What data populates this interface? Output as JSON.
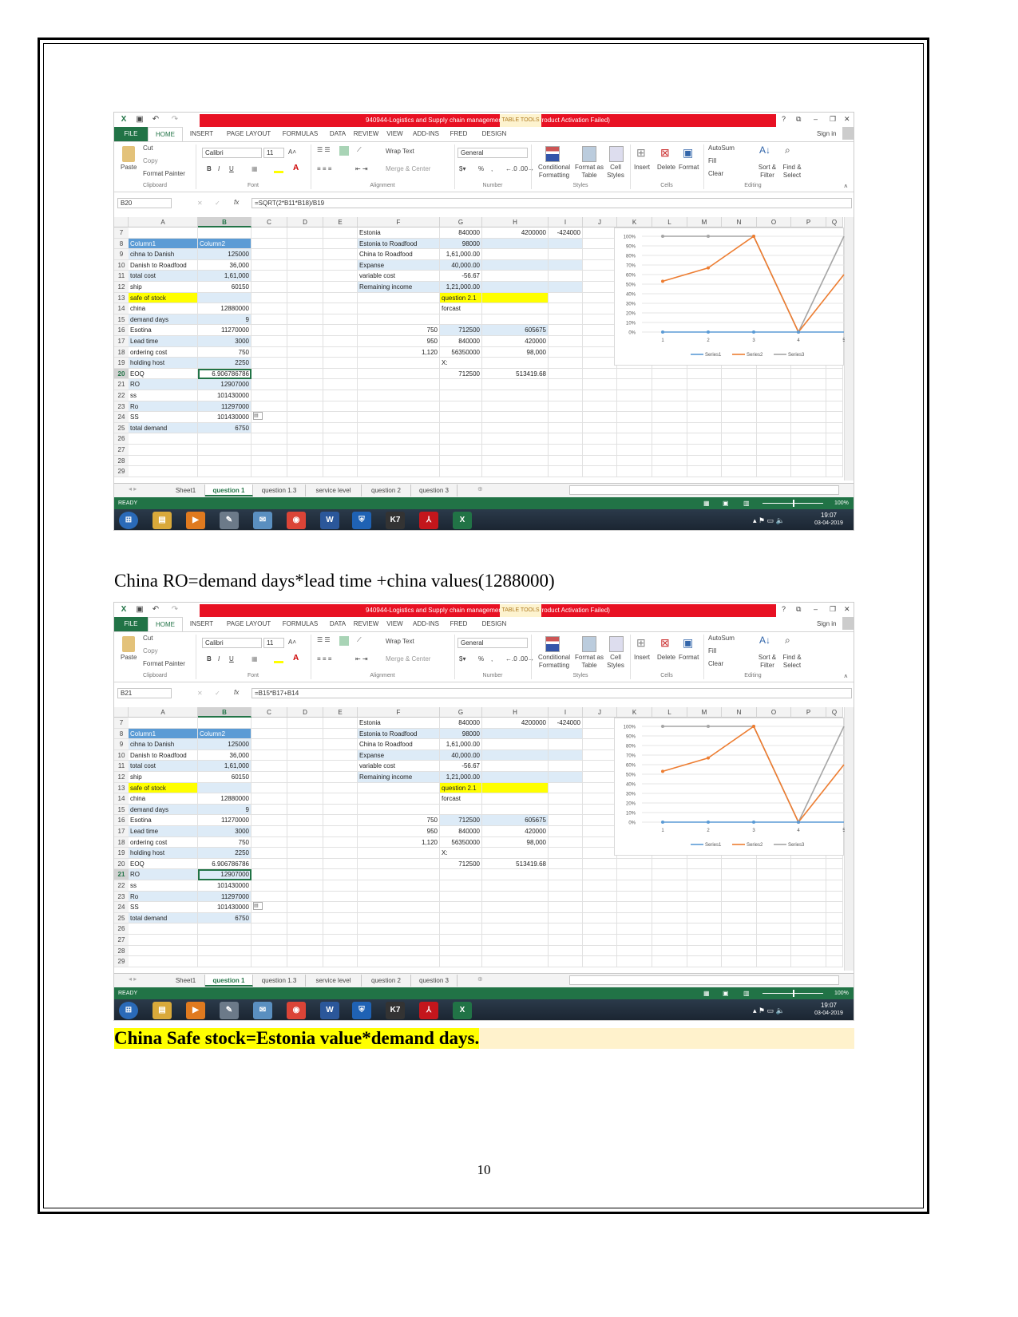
{
  "document": {
    "caption1": "China RO=demand days*lead time +china values(1288000)",
    "caption2": "China Safe stock=Estonia value*demand days.",
    "page_number": "10"
  },
  "excel": {
    "window_title": "940944-Logistics and Supply chain management v1  -  Excel (Product Activation Failed)",
    "table_tools": "TABLE TOOLS",
    "sign_in": "Sign in",
    "window_controls": [
      "?",
      "⧉",
      "–",
      "❐",
      "✕"
    ],
    "ribbon_tabs": [
      "FILE",
      "HOME",
      "INSERT",
      "PAGE LAYOUT",
      "FORMULAS",
      "DATA",
      "REVIEW",
      "VIEW",
      "ADD-INS",
      "FRED",
      "DESIGN"
    ],
    "ribbon": {
      "paste": "Paste",
      "cut": "Cut",
      "copy": "Copy",
      "format_painter": "Format Painter",
      "font_name": "Calibri",
      "font_size": "11",
      "bold": "B",
      "italic": "I",
      "underline": "U",
      "wrap_text": "Wrap Text",
      "merge_center": "Merge & Center",
      "number_format": "General",
      "percent": "%",
      "comma": ",",
      "conditional_formatting": "Conditional Formatting",
      "format_as_table": "Format as Table",
      "cell_styles": "Cell Styles",
      "insert": "Insert",
      "delete": "Delete",
      "format": "Format",
      "autosum": "AutoSum",
      "fill": "Fill",
      "clear": "Clear",
      "sort_filter": "Sort & Filter",
      "find_select": "Find & Select",
      "groups": [
        "Clipboard",
        "Font",
        "Alignment",
        "Number",
        "Styles",
        "Cells",
        "Editing"
      ]
    },
    "fx": "fx",
    "columns": [
      "A",
      "B",
      "C",
      "D",
      "E",
      "F",
      "G",
      "H",
      "I",
      "J",
      "K",
      "L",
      "M",
      "N",
      "O",
      "P",
      "Q"
    ],
    "rows": [
      7,
      8,
      9,
      10,
      11,
      12,
      13,
      14,
      15,
      16,
      17,
      18,
      19,
      20,
      21,
      22,
      23,
      24,
      25,
      26,
      27,
      28,
      29
    ],
    "cells": [
      [
        "F7",
        "Estonia",
        ""
      ],
      [
        "G7",
        "840000",
        ""
      ],
      [
        "H7",
        "4200000",
        ""
      ],
      [
        "I7",
        "-424000",
        ""
      ],
      [
        "A8",
        "Column1",
        "hdr"
      ],
      [
        "B8",
        "Column2",
        "hdr"
      ],
      [
        "F8",
        "Estonia to Roadfood",
        "band"
      ],
      [
        "G8",
        "98000",
        "band"
      ],
      [
        "H8",
        "",
        "band"
      ],
      [
        "I8",
        "",
        "band"
      ],
      [
        "A9",
        "cihna to Danish",
        "band"
      ],
      [
        "B9",
        "125000",
        "band"
      ],
      [
        "F9",
        "China to Roadfood",
        ""
      ],
      [
        "G9",
        "1,61,000.00",
        ""
      ],
      [
        "A10",
        "Danish to Roadfood",
        ""
      ],
      [
        "B10",
        "36,000",
        ""
      ],
      [
        "F10",
        "Expanse",
        "band"
      ],
      [
        "G10",
        "40,000.00",
        "band"
      ],
      [
        "H10",
        "",
        "band"
      ],
      [
        "I10",
        "",
        "band"
      ],
      [
        "A11",
        "total cost",
        "band"
      ],
      [
        "B11",
        "1,61,000",
        "band"
      ],
      [
        "F11",
        "variable cost",
        ""
      ],
      [
        "G11",
        "-56.67",
        ""
      ],
      [
        "A12",
        "ship",
        ""
      ],
      [
        "B12",
        "60150",
        ""
      ],
      [
        "F12",
        "Remaining income",
        "band"
      ],
      [
        "G12",
        "1,21,000.00",
        "band"
      ],
      [
        "H12",
        "",
        "band"
      ],
      [
        "I12",
        "",
        "band"
      ],
      [
        "A13",
        "safe of stock",
        "yellow"
      ],
      [
        "B13",
        "",
        "band"
      ],
      [
        "G13",
        "question 2.1",
        "yellow"
      ],
      [
        "H13",
        "",
        "yellow"
      ],
      [
        "A14",
        "china",
        ""
      ],
      [
        "B14",
        "12880000",
        ""
      ],
      [
        "G14",
        "forcast",
        ""
      ],
      [
        "A15",
        "demand days",
        "band"
      ],
      [
        "B15",
        "9",
        "band"
      ],
      [
        "A16",
        "Esotina",
        ""
      ],
      [
        "B16",
        "11270000",
        ""
      ],
      [
        "F16",
        "750",
        ""
      ],
      [
        "G16",
        "712500",
        "band"
      ],
      [
        "H16",
        "605675",
        "band"
      ],
      [
        "A17",
        "Lead time",
        "band"
      ],
      [
        "B17",
        "3000",
        "band"
      ],
      [
        "F17",
        "950",
        ""
      ],
      [
        "G17",
        "840000",
        ""
      ],
      [
        "H17",
        "420000",
        ""
      ],
      [
        "A18",
        "ordering cost",
        ""
      ],
      [
        "B18",
        "750",
        ""
      ],
      [
        "F18",
        "1,120",
        ""
      ],
      [
        "G18",
        "56350000",
        ""
      ],
      [
        "H18",
        "98,000",
        ""
      ],
      [
        "A19",
        "holding host",
        "band"
      ],
      [
        "B19",
        "2250",
        "band"
      ],
      [
        "G19",
        "X:",
        ""
      ],
      [
        "A20",
        "EOQ",
        ""
      ],
      [
        "B20",
        "6.906786786",
        ""
      ],
      [
        "G20",
        "712500",
        ""
      ],
      [
        "H20",
        "513419.68",
        ""
      ],
      [
        "A21",
        "RO",
        "band"
      ],
      [
        "B21",
        "12907000",
        "band"
      ],
      [
        "A22",
        "ss",
        ""
      ],
      [
        "B22",
        "101430000",
        ""
      ],
      [
        "A23",
        "Ro",
        "band"
      ],
      [
        "B23",
        "11297000",
        "band"
      ],
      [
        "A24",
        "SS",
        ""
      ],
      [
        "B24",
        "101430000",
        ""
      ],
      [
        "A25",
        "total demand",
        "band"
      ],
      [
        "B25",
        "6750",
        "band"
      ]
    ],
    "chart": {
      "type": "line",
      "categories": [
        "1",
        "2",
        "3",
        "4",
        "5"
      ],
      "y_ticks": [
        "0%",
        "10%",
        "20%",
        "30%",
        "40%",
        "50%",
        "60%",
        "70%",
        "80%",
        "90%",
        "100%"
      ],
      "ylim": [
        0,
        100
      ],
      "grid": true,
      "legend_position": "bottom",
      "series": [
        {
          "name": "Series1",
          "values": [
            0,
            0,
            0,
            0,
            0
          ],
          "color": "#5b9bd5"
        },
        {
          "name": "Series2",
          "values": [
            53,
            67,
            100,
            0,
            60
          ],
          "color": "#ed7d31"
        },
        {
          "name": "Series3",
          "values": [
            100,
            100,
            100,
            0,
            100
          ],
          "color": "#a5a5a5"
        }
      ]
    },
    "sheet_tabs": [
      "Sheet1",
      "question 1",
      "question 1.3",
      "service level",
      "question 2",
      "question 3"
    ],
    "active_sheet": "question 1",
    "status": "READY",
    "zoom": "100%",
    "time": "19:07",
    "date": "03-04-2019",
    "taskbar_apps": [
      {
        "name": "start",
        "glyph": "⊞",
        "color": "#2a6ab8"
      },
      {
        "name": "explorer",
        "glyph": "▤",
        "color": "#d9a93a"
      },
      {
        "name": "media-player",
        "glyph": "▶",
        "color": "#e07a1f"
      },
      {
        "name": "paint",
        "glyph": "✎",
        "color": "#6c7a89"
      },
      {
        "name": "notes",
        "glyph": "✉",
        "color": "#5a8fc0"
      },
      {
        "name": "chrome",
        "glyph": "◉",
        "color": "#db4437"
      },
      {
        "name": "word",
        "glyph": "W",
        "color": "#2b579a"
      },
      {
        "name": "security",
        "glyph": "⛨",
        "color": "#1f62b4"
      },
      {
        "name": "k7",
        "glyph": "K7",
        "color": "#333333"
      },
      {
        "name": "acrobat",
        "glyph": "⅄",
        "color": "#c4161c"
      },
      {
        "name": "excel",
        "glyph": "X",
        "color": "#217346"
      }
    ],
    "colors": {
      "excel_green": "#217346",
      "title_red": "#e81123",
      "table_header": "#5b9bd5",
      "band": "#ddebf7",
      "highlight": "#ffff00"
    }
  },
  "screenshots": [
    {
      "name_box": "B20",
      "formula": "=SQRT(2*B11*B18)/B19",
      "active_cell": "B20"
    },
    {
      "name_box": "B21",
      "formula": "=B15*B17+B14",
      "active_cell": "B21"
    }
  ]
}
